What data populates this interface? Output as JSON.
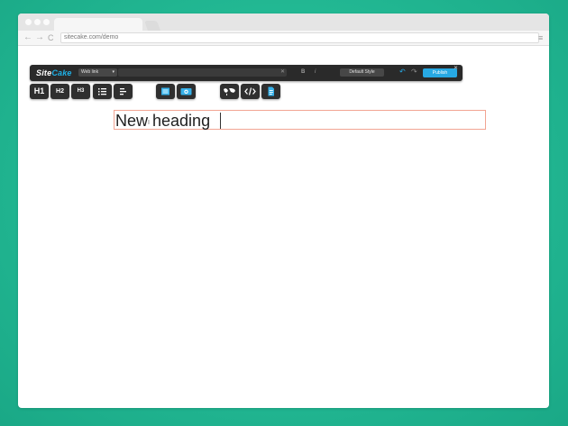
{
  "browser": {
    "url": "sitecake.com/demo",
    "nav": {
      "back": "←",
      "forward": "→",
      "reload": "C"
    },
    "menu_icon": "≡"
  },
  "sitecake_bar": {
    "logo_site": "Site",
    "logo_cake": "Cake",
    "link_type": "Web link",
    "link_type_caret": "▾",
    "clear": "✕",
    "bold": "B",
    "italic": "i",
    "style_select": "Default Style",
    "undo": "↶",
    "redo": "↷",
    "publish": "Publish",
    "close": "✕"
  },
  "toolbar": {
    "h1": "H1",
    "h2": "H2",
    "h3": "H3",
    "icons": [
      "list-icon",
      "align-icon",
      "image-icon",
      "slideshow-icon",
      "map-icon",
      "html-icon",
      "file-icon"
    ]
  },
  "editor": {
    "heading": "New heading"
  },
  "colors": {
    "background": "#22b893",
    "toolbar": "#2a2a2a",
    "accent": "#27a9e4",
    "logo_cake": "#1fb0e6",
    "selection_border": "#f2a493"
  }
}
